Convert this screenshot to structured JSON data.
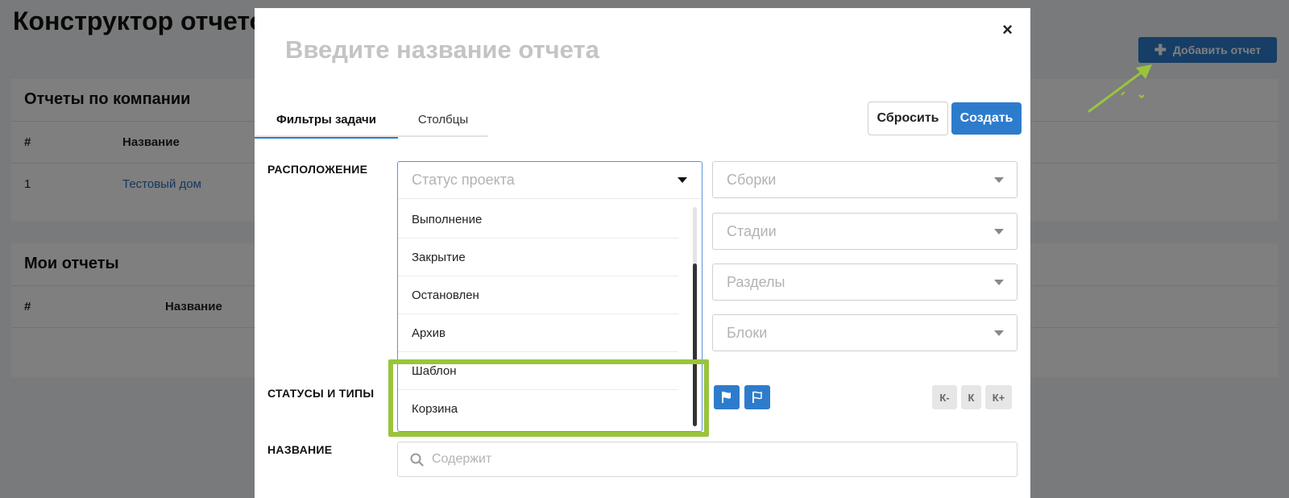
{
  "page": {
    "title": "Конструктор отчетов",
    "add_report_label": "Добавить отчет",
    "company_reports": {
      "title": "Отчеты по компании",
      "columns": [
        "#",
        "Название"
      ],
      "rows": [
        {
          "num": "1",
          "name": "Тестовый дом"
        }
      ]
    },
    "my_reports": {
      "title": "Мои отчеты",
      "columns": [
        "#",
        "Название"
      ]
    }
  },
  "modal": {
    "title_placeholder": "Введите название отчета",
    "close_glyph": "×",
    "tabs": [
      {
        "label": "Фильтры задачи",
        "active": true
      },
      {
        "label": "Столбцы",
        "active": false
      }
    ],
    "reset_label": "Сбросить",
    "create_label": "Создать",
    "location_label": "РАСПОЛОЖЕНИЕ",
    "statuses_label": "СТАТУСЫ И ТИПЫ",
    "name_label": "НАЗВАНИЕ",
    "project_status": {
      "placeholder": "Статус проекта",
      "options": [
        "Выполнение",
        "Закрытие",
        "Остановлен",
        "Архив",
        "Шаблон",
        "Корзина"
      ]
    },
    "selects": {
      "builds": "Сборки",
      "stages": "Стадии",
      "sections": "Разделы",
      "blocks": "Блоки"
    },
    "k_buttons": [
      "К-",
      "К",
      "К+"
    ],
    "search_placeholder": "Содержит"
  },
  "colors": {
    "accent": "#2d7ccc",
    "highlight": "#9ac43c",
    "placeholder": "#b3b3b3"
  }
}
